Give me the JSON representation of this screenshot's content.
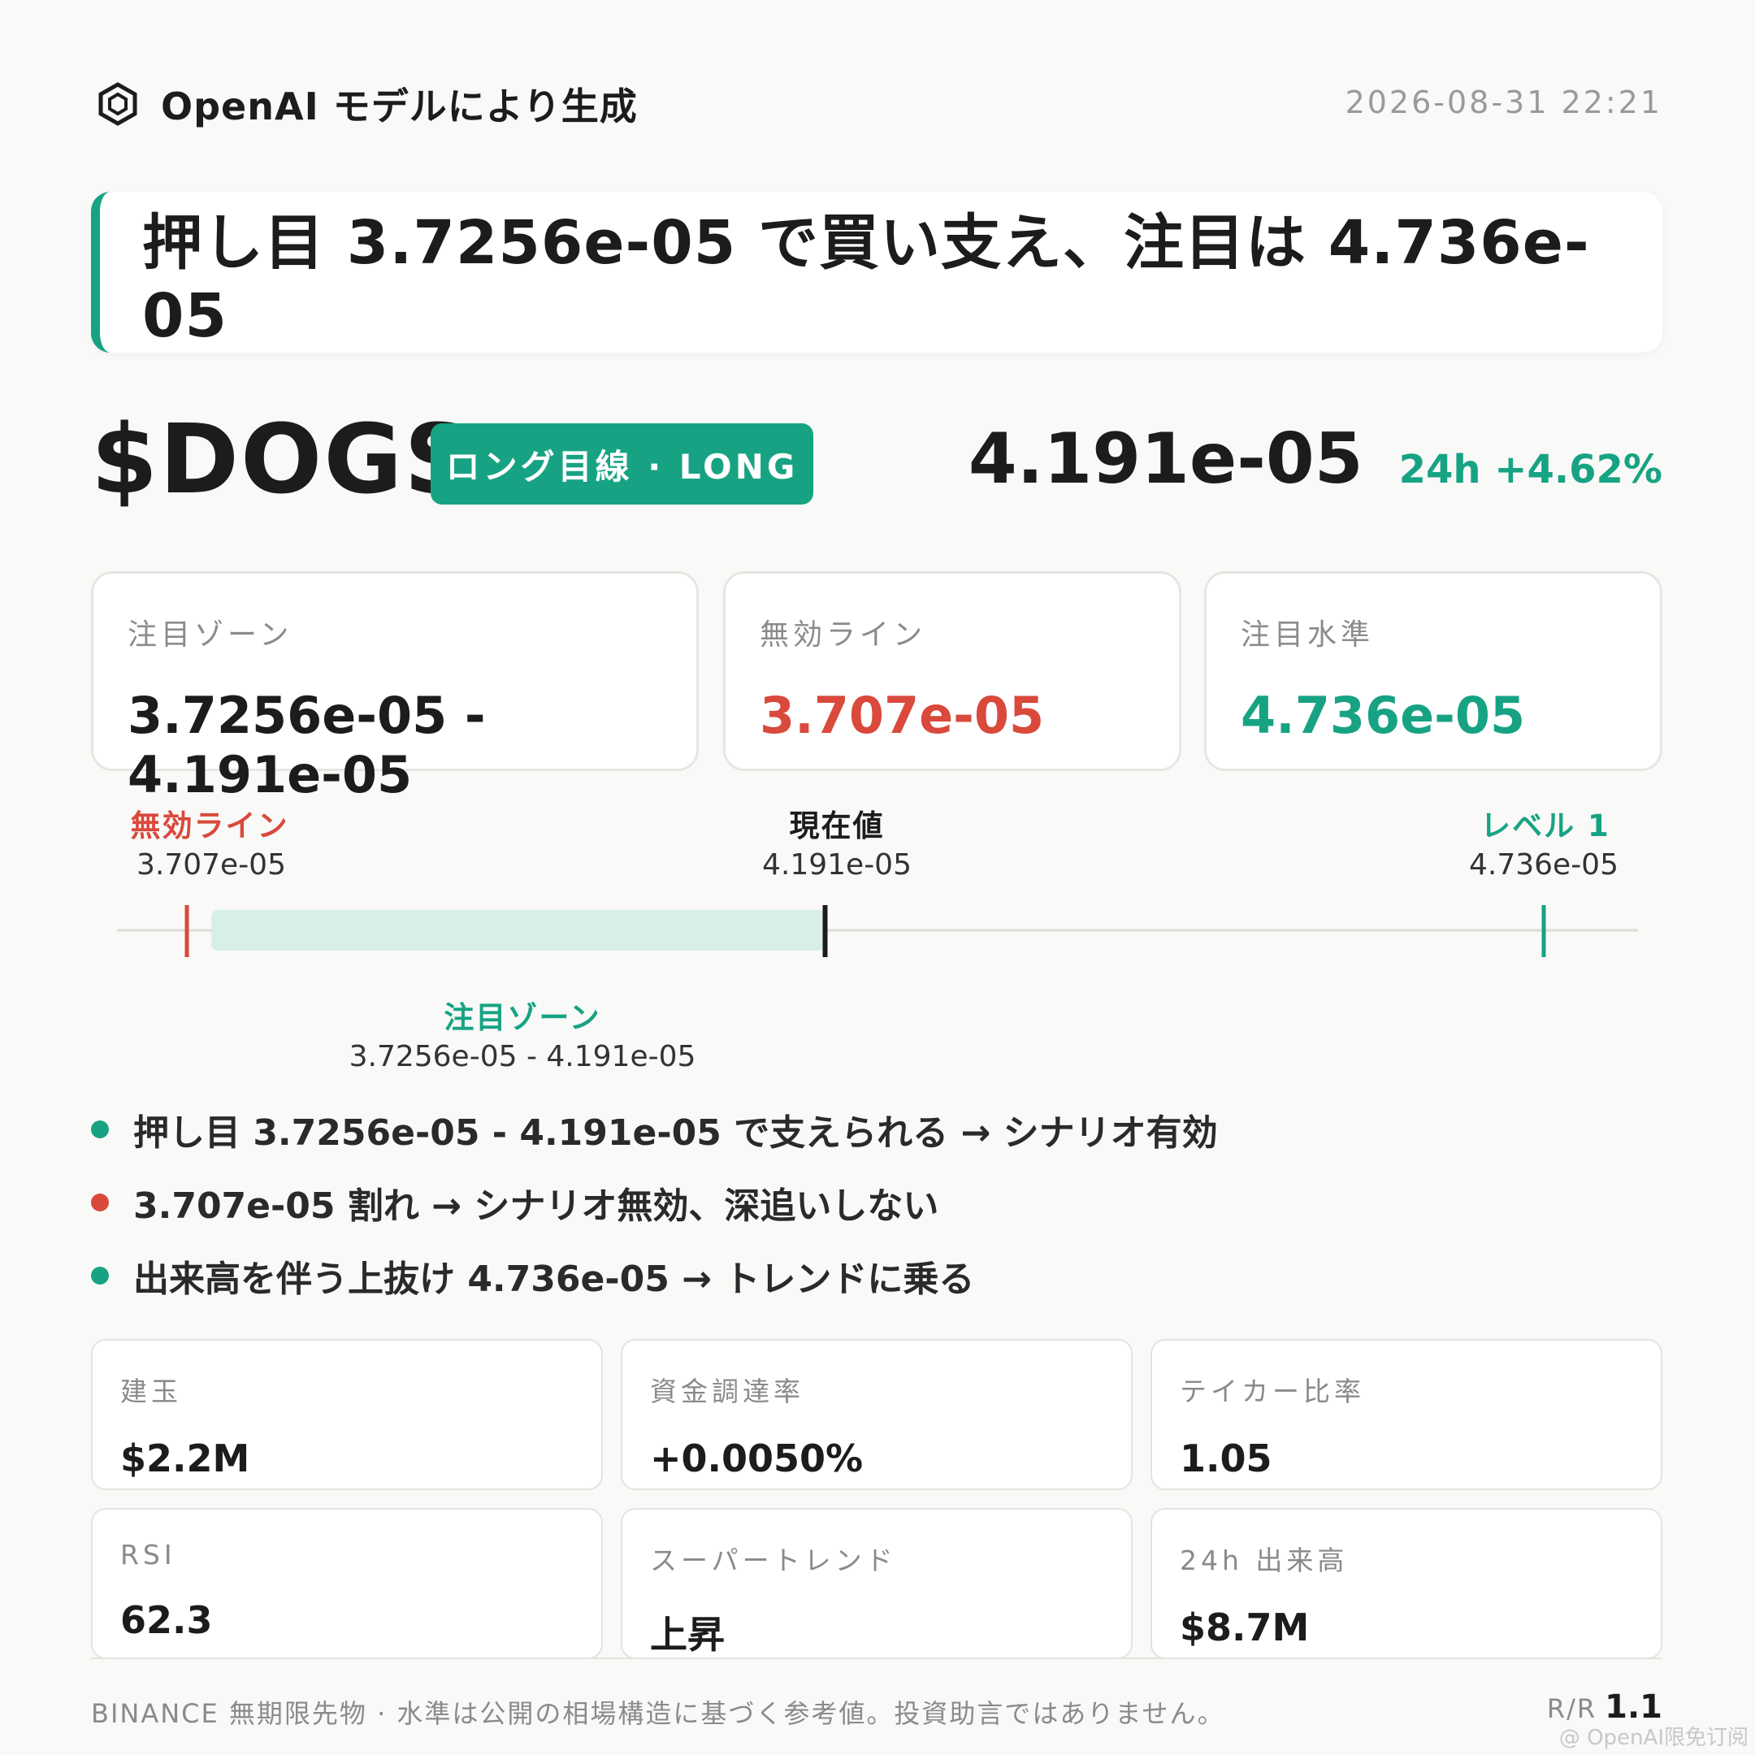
{
  "header": {
    "brand": "OpenAI モデルにより生成",
    "brand_icon": "hexagon-logo-icon",
    "timestamp": "2026-08-31 22:21"
  },
  "headline": "押し目 3.7256e-05 で買い支え、注目は 4.736e-05",
  "ticker": {
    "symbol": "$DOGS",
    "side_badge": "ロング目線 · LONG",
    "price": "4.191e-05",
    "change_24h": "24h +4.62%"
  },
  "levels": [
    {
      "label": "注目ゾーン",
      "value": "3.7256e-05 - 4.191e-05"
    },
    {
      "label": "無効ライン",
      "value": "3.707e-05"
    },
    {
      "label": "注目水準",
      "value": "4.736e-05"
    }
  ],
  "track": {
    "invalidation": {
      "label": "無効ライン",
      "value": "3.707e-05",
      "price": 3.707e-05
    },
    "current": {
      "label": "現在値",
      "value": "4.191e-05",
      "price": 4.191e-05
    },
    "target": {
      "label": "レベル 1",
      "value": "4.736e-05",
      "price": 4.736e-05
    },
    "zone": {
      "label": "注目ゾーン",
      "value": "3.7256e-05 - 4.191e-05",
      "low": 3.7256e-05,
      "high": 4.191e-05
    }
  },
  "bullets": [
    {
      "text": "押し目 3.7256e-05 - 4.191e-05 で支えられる → シナリオ有効",
      "color": "#17a383"
    },
    {
      "text": "3.707e-05 割れ → シナリオ無効、深追いしない",
      "color": "#d9493c"
    },
    {
      "text": "出来高を伴う上抜け 4.736e-05 → トレンドに乗る",
      "color": "#17a383"
    }
  ],
  "metrics": [
    {
      "label": "建玉",
      "value": "$2.2M"
    },
    {
      "label": "資金調達率",
      "value": "+0.0050%"
    },
    {
      "label": "テイカー比率",
      "value": "1.05"
    },
    {
      "label": "RSI",
      "value": "62.3"
    },
    {
      "label": "スーパートレンド",
      "value": "上昇"
    },
    {
      "label": "24h 出来高",
      "value": "$8.7M"
    }
  ],
  "footer": {
    "disclaimer": "BINANCE 無期限先物 · 水準は公開の相場構造に基づく参考値。投資助言ではありません。",
    "rr_label": "R/R",
    "rr_value": "1.1",
    "watermark": "@ OpenAI限免订阅"
  },
  "colors": {
    "accent": "#17a383",
    "danger": "#d9493c",
    "zone_fill": "#d8efe7"
  }
}
